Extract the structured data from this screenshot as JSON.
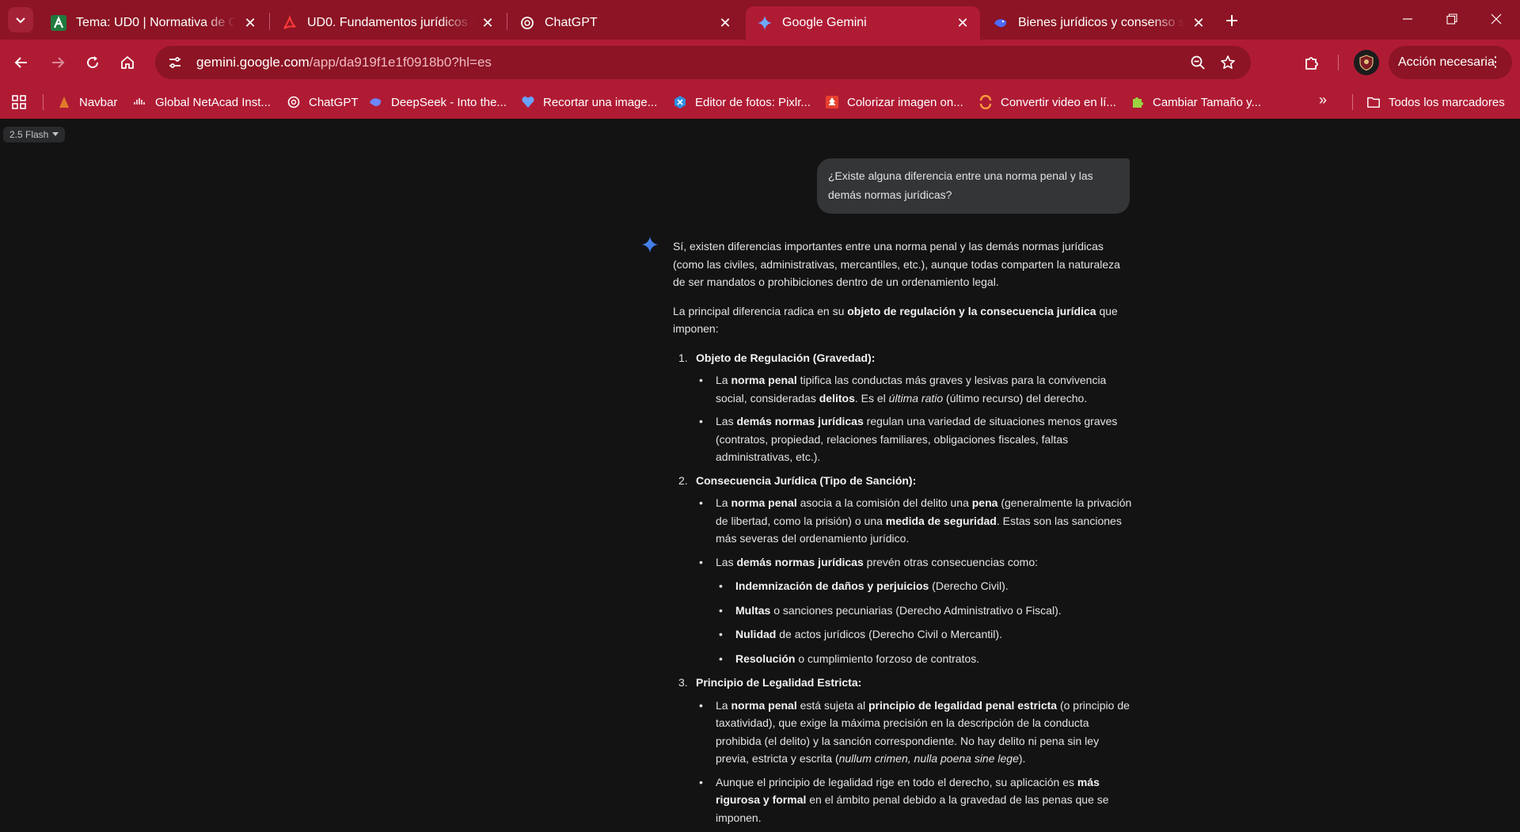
{
  "browser": {
    "tabs": [
      {
        "title": "Tema: UD0 | Normativa de Ciberseguridad",
        "icon": "moodle-a-icon",
        "active": false
      },
      {
        "title": "UD0. Fundamentos jurídicos de",
        "icon": "pdf-icon",
        "active": false
      },
      {
        "title": "ChatGPT",
        "icon": "openai-icon",
        "active": false
      },
      {
        "title": "Google Gemini",
        "icon": "gemini-icon",
        "active": true
      },
      {
        "title": "Bienes jurídicos y consenso social",
        "icon": "deepseek-icon",
        "active": false
      }
    ],
    "url_host": "gemini.google.com",
    "url_path": "/app/da919f1e1f0918b0?hl=es",
    "action_button": "Acción necesaria",
    "bookmarks": [
      {
        "label": "Navbar",
        "icon": "navbar-icon"
      },
      {
        "label": "Global NetAcad Inst...",
        "icon": "cisco-icon"
      },
      {
        "label": "ChatGPT",
        "icon": "openai-icon"
      },
      {
        "label": "DeepSeek - Into the...",
        "icon": "deepseek-icon"
      },
      {
        "label": "Recortar una image...",
        "icon": "heart-icon"
      },
      {
        "label": "Editor de fotos: Pixlr...",
        "icon": "pixlr-icon"
      },
      {
        "label": "Colorizar imagen on...",
        "icon": "tree-icon"
      },
      {
        "label": "Convertir video en lí...",
        "icon": "convert-icon"
      },
      {
        "label": "Cambiar Tamaño y...",
        "icon": "puzzle-icon"
      }
    ],
    "all_bookmarks": "Todos los marcadores",
    "colors": {
      "tabstrip": "#8c1424",
      "toolbar": "#b01b34",
      "page": "#131314"
    }
  },
  "chat": {
    "model": "2.5 Flash",
    "user_prompt": "¿Existe alguna diferencia entre una norma penal y las demás normas jurídicas?",
    "answer": {
      "intro": "Sí, existen diferencias importantes entre una norma penal y las demás normas jurídicas (como las civiles, administrativas, mercantiles, etc.), aunque todas comparten la naturaleza de ser mandatos o prohibiciones dentro de un ordenamiento legal.",
      "p2_a": "La principal diferencia radica en su ",
      "p2_b": "objeto de regulación y la consecuencia jurídica",
      "p2_c": " que imponen:",
      "sections": [
        {
          "num": "1.",
          "heading": "Objeto de Regulación (Gravedad):",
          "s1": [
            "La ",
            "norma penal",
            " tipifica las conductas más graves y lesivas para la convivencia social, consideradas ",
            "delitos",
            ". Es el ",
            "última ratio",
            " (último recurso) del derecho."
          ],
          "s2": [
            "Las ",
            "demás normas jurídicas",
            " regulan una variedad de situaciones menos graves (contratos, propiedad, relaciones familiares, obligaciones fiscales, faltas administrativas, etc.)."
          ]
        },
        {
          "num": "2.",
          "heading": "Consecuencia Jurídica (Tipo de Sanción):",
          "s1": [
            "La ",
            "norma penal",
            " asocia a la comisión del delito una ",
            "pena",
            " (generalmente la privación de libertad, como la prisión) o una ",
            "medida de seguridad",
            ". Estas son las sanciones más severas del ordenamiento jurídico."
          ],
          "s2": [
            "Las ",
            "demás normas jurídicas",
            " prevén otras consecuencias como:"
          ],
          "sub": [
            {
              "b": "Indemnización de daños y perjuicios",
              "t": " (Derecho Civil)."
            },
            {
              "b": "Multas",
              "t": " o sanciones pecuniarias (Derecho Administrativo o Fiscal)."
            },
            {
              "b": "Nulidad",
              "t": " de actos jurídicos (Derecho Civil o Mercantil)."
            },
            {
              "b": "Resolución",
              "t": " o cumplimiento forzoso de contratos."
            }
          ]
        },
        {
          "num": "3.",
          "heading": "Principio de Legalidad Estricta:",
          "s1": [
            "La ",
            "norma penal",
            " está sujeta al ",
            "principio de legalidad penal estricta",
            " (o principio de taxatividad), que exige la máxima precisión en la descripción de la conducta prohibida (el delito) y la sanción correspondiente. No hay delito ni pena sin ley previa, estricta y escrita (",
            "nullum crimen, nulla poena sine lege",
            ")."
          ],
          "s2": [
            "Aunque el principio de legalidad rige en todo el derecho, su aplicación es ",
            "más rigurosa y formal",
            " en el ámbito penal debido a la gravedad de las penas que se imponen."
          ]
        }
      ]
    }
  }
}
